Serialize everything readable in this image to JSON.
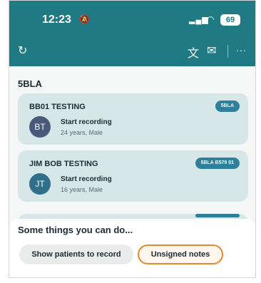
{
  "status_bar": {
    "time": "12:23",
    "silent_icon": "🔕",
    "signal_icon": "▂▄▆",
    "wifi_icon": "◠",
    "battery": "69"
  },
  "toolbar": {
    "refresh_icon": "↻",
    "translate_icon": "文",
    "mail_icon": "✉",
    "more_icon": "···"
  },
  "section_title": "5BLA",
  "patients": [
    {
      "name": "BB01 TESTING",
      "badge": "5BLA",
      "initials": "BT",
      "avatar_color": "#4a587a",
      "action": "Start recording",
      "meta": "24 years, Male"
    },
    {
      "name": "JIM BOB TESTING",
      "badge": "5BLA B579 01",
      "initials": "JT",
      "avatar_color": "#2f6f8a",
      "action": "Start recording",
      "meta": "16 years, Male"
    }
  ],
  "suggestions": {
    "heading": "Some things you can do...",
    "chips": [
      "Show patients to record",
      "Unsigned notes"
    ]
  },
  "colors": {
    "brand": "#1f7a84",
    "card": "#d7e7e8",
    "highlight": "#e8892f"
  }
}
